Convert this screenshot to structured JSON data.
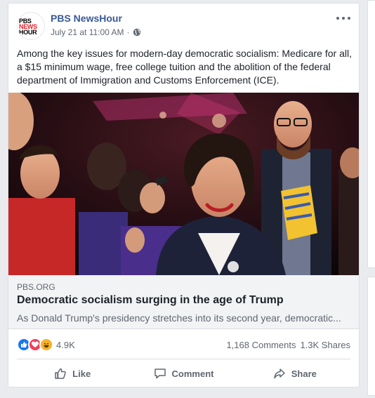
{
  "post": {
    "page_name": "PBS NewsHour",
    "logo": {
      "line1": "PBS",
      "line2": "NEWS",
      "line3": "HOUR"
    },
    "timestamp": "July 21 at 11:00 AM",
    "separator": "·",
    "privacy_icon": "globe-icon",
    "more_icon": "ellipsis-icon",
    "text": "Among the key issues for modern-day democratic socialism: Medicare for all, a $15 minimum wage, free college tuition and the abolition of the federal department of Immigration and Customs Enforcement (ICE)."
  },
  "link_preview": {
    "domain": "PBS.ORG",
    "title": "Democratic socialism surging in the age of Trump",
    "description": "As Donald Trump's presidency stretches into its second year, democratic..."
  },
  "stats": {
    "reactions_count": "4.9K",
    "reaction_icons": [
      "like-icon",
      "love-icon",
      "haha-icon"
    ],
    "comments": "1,168 Comments",
    "shares": "1.3K Shares"
  },
  "actions": {
    "like": "Like",
    "comment": "Comment",
    "share": "Share"
  },
  "colors": {
    "link_blue": "#385898",
    "like_blue": "#1877f2",
    "love_red": "#f33e58",
    "haha_yellow": "#f7b125",
    "pbs_red": "#e0232a"
  }
}
